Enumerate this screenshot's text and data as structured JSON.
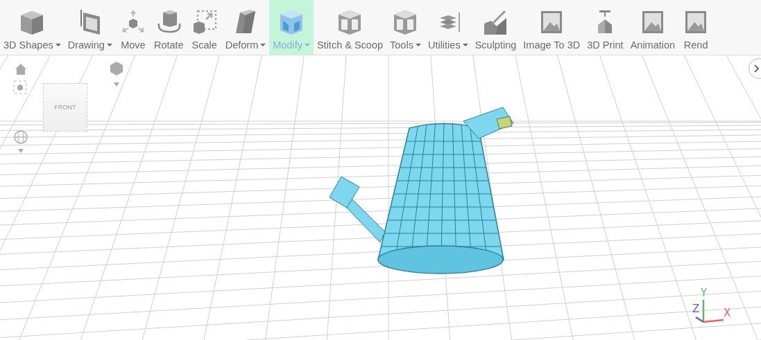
{
  "toolbar": {
    "items": [
      {
        "label": "3D Shapes",
        "dropdown": true,
        "selected": false,
        "kind": "cube"
      },
      {
        "label": "Drawing",
        "dropdown": true,
        "selected": false,
        "kind": "drawing"
      },
      {
        "label": "Move",
        "dropdown": false,
        "selected": false,
        "kind": "move"
      },
      {
        "label": "Rotate",
        "dropdown": false,
        "selected": false,
        "kind": "rotate"
      },
      {
        "label": "Scale",
        "dropdown": false,
        "selected": false,
        "kind": "scale"
      },
      {
        "label": "Deform",
        "dropdown": true,
        "selected": false,
        "kind": "deform"
      },
      {
        "label": "Modify",
        "dropdown": true,
        "selected": true,
        "kind": "modify"
      },
      {
        "label": "Stitch & Scoop",
        "dropdown": false,
        "selected": false,
        "kind": "hollow"
      },
      {
        "label": "Tools",
        "dropdown": true,
        "selected": false,
        "kind": "hollow"
      },
      {
        "label": "Utilities",
        "dropdown": true,
        "selected": false,
        "kind": "layers"
      },
      {
        "label": "Sculpting",
        "dropdown": false,
        "selected": false,
        "kind": "sculpt"
      },
      {
        "label": "Image To 3D",
        "dropdown": false,
        "selected": false,
        "kind": "image"
      },
      {
        "label": "3D Print",
        "dropdown": false,
        "selected": false,
        "kind": "print"
      },
      {
        "label": "Animation",
        "dropdown": false,
        "selected": false,
        "kind": "image"
      },
      {
        "label": "Rend",
        "dropdown": false,
        "selected": false,
        "kind": "image"
      }
    ]
  },
  "view_cube": {
    "face_label": "FRONT"
  },
  "axes": {
    "x": "X",
    "y": "Y",
    "z": "Z"
  }
}
